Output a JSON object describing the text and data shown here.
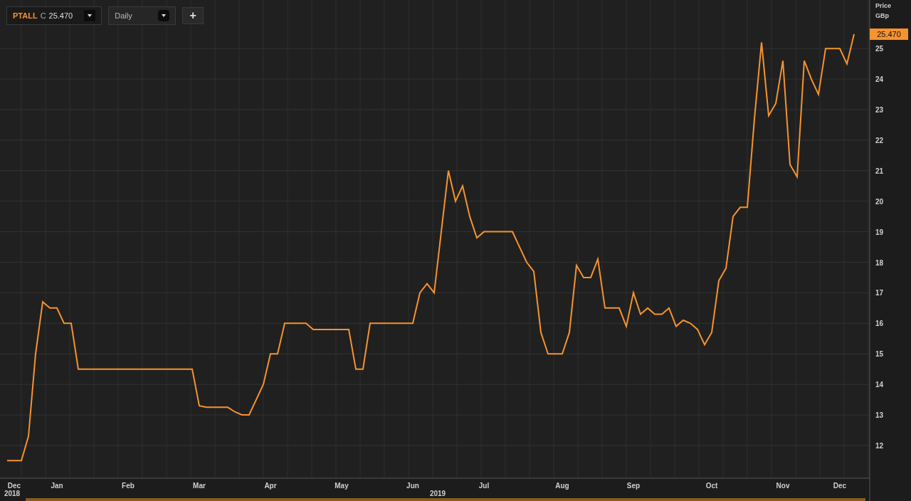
{
  "toolbar": {
    "price_prefix": "C",
    "price": "25.470",
    "interval": "Daily",
    "add_button": "+"
  },
  "axis": {
    "title": "Price",
    "unit": "GBp",
    "last_price": "25.470"
  },
  "chart_data": {
    "type": "line",
    "categories": [
      null,
      "Dec",
      null,
      null,
      null,
      null,
      null,
      "Jan",
      null,
      null,
      null,
      null,
      null,
      null,
      null,
      null,
      null,
      "Feb",
      null,
      null,
      null,
      null,
      null,
      null,
      null,
      null,
      null,
      "Mar",
      null,
      null,
      null,
      null,
      null,
      null,
      null,
      null,
      null,
      "Apr",
      null,
      null,
      null,
      null,
      null,
      null,
      null,
      null,
      null,
      "May",
      null,
      null,
      null,
      null,
      null,
      null,
      null,
      null,
      null,
      "Jun",
      null,
      null,
      null,
      null,
      null,
      null,
      null,
      null,
      null,
      "Jul",
      null,
      null,
      null,
      null,
      null,
      null,
      null,
      null,
      null,
      null,
      "Aug",
      null,
      null,
      null,
      null,
      null,
      null,
      null,
      null,
      null,
      "Sep",
      null,
      null,
      null,
      null,
      null,
      null,
      null,
      null,
      null,
      null,
      "Oct",
      null,
      null,
      null,
      null,
      null,
      null,
      null,
      null,
      null,
      "Nov",
      null,
      null,
      null,
      null,
      null,
      null,
      null,
      "Dec",
      null,
      null
    ],
    "series": [
      {
        "name": "PTALL",
        "color": "#f7932f",
        "values": [
          11.5,
          11.5,
          11.5,
          12.3,
          15,
          16.7,
          16.5,
          16.5,
          16,
          16,
          14.5,
          14.5,
          14.5,
          14.5,
          14.5,
          14.5,
          14.5,
          14.5,
          14.5,
          14.5,
          14.5,
          14.5,
          14.5,
          14.5,
          14.5,
          14.5,
          14.5,
          13.3,
          13.25,
          13.25,
          13.25,
          13.25,
          13.1,
          13,
          13,
          13.5,
          14,
          15,
          15,
          16,
          16,
          16,
          16,
          15.8,
          15.8,
          15.8,
          15.8,
          15.8,
          15.8,
          14.5,
          14.5,
          16,
          16,
          16,
          16,
          16,
          16,
          16,
          17,
          17.3,
          17,
          19,
          21,
          20,
          20.5,
          19.5,
          18.8,
          19,
          19,
          19,
          19,
          19,
          18.5,
          18,
          17.7,
          15.7,
          15,
          15,
          15,
          15.7,
          17.9,
          17.5,
          17.5,
          18.1,
          16.5,
          16.5,
          16.5,
          15.9,
          17,
          16.3,
          16.5,
          16.3,
          16.3,
          16.5,
          15.9,
          16.1,
          16,
          15.8,
          15.3,
          15.7,
          17.4,
          17.8,
          19.5,
          19.8,
          19.8,
          22.7,
          25.2,
          22.8,
          23.2,
          24.6,
          21.2,
          20.8,
          24.6,
          24,
          23.5,
          25,
          25,
          25,
          24.5,
          25.47
        ]
      }
    ],
    "ylim": [
      10.18,
      26.59
    ],
    "grid": true,
    "yticks": [
      12,
      13,
      14,
      15,
      16,
      17,
      18,
      19,
      20,
      21,
      22,
      23,
      24,
      25
    ]
  },
  "time_axis": {
    "years": [
      "2018",
      "2019"
    ]
  }
}
